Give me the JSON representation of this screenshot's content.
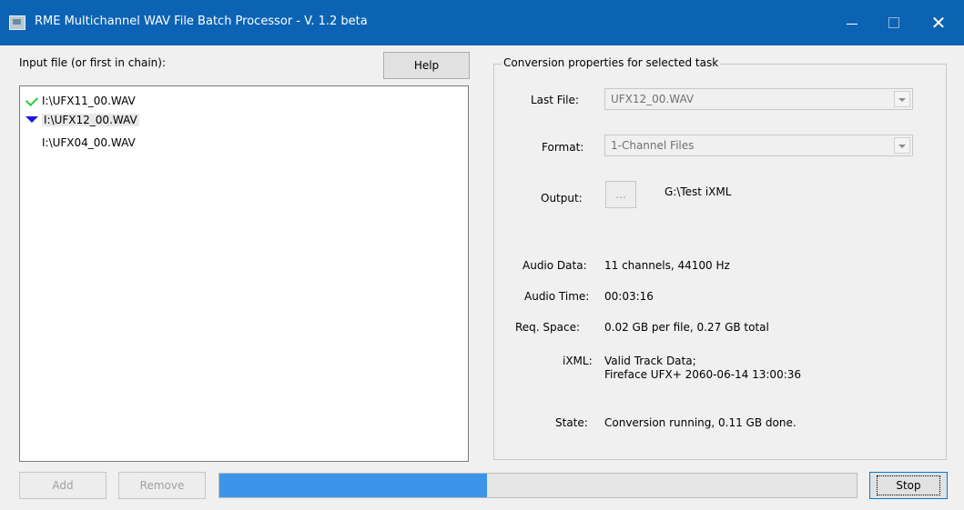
{
  "window": {
    "title": "RME Multichannel WAV File Batch Processor - V. 1.2 beta",
    "close_glyph": "✕"
  },
  "input": {
    "label": "Input file (or first in chain):",
    "help_label": "Help",
    "files": [
      {
        "name": "I:\\UFX11_00.WAV",
        "status_icon": "green-check-icon"
      },
      {
        "name": "I:\\UFX12_00.WAV",
        "status_icon": "blue-chevron-icon",
        "selected": true
      },
      {
        "name": "I:\\UFX04_00.WAV",
        "status_icon": "none"
      }
    ]
  },
  "props": {
    "group_title": "Conversion properties for selected task",
    "last_file_label": "Last File:",
    "last_file_value": "UFX12_00.WAV",
    "format_label": "Format:",
    "format_value": "1-Channel Files",
    "output_label": "Output:",
    "output_browse": "...",
    "output_value": "G:\\Test iXML",
    "audio_data_label": "Audio Data:",
    "audio_data_value": "11 channels, 44100 Hz",
    "audio_time_label": "Audio Time:",
    "audio_time_value": "00:03:16",
    "req_space_label": "Req. Space:",
    "req_space_value": "0.02 GB per file, 0.27 GB total",
    "ixml_label": "iXML:",
    "ixml_value_line1": "Valid Track Data;",
    "ixml_value_line2": "Fireface UFX+ 2060-06-14 13:00:36",
    "state_label": "State:",
    "state_value": "Conversion running, 0.11 GB done."
  },
  "footer": {
    "add_label": "Add",
    "remove_label": "Remove",
    "progress_fraction": 0.42,
    "stop_label": "Stop"
  },
  "colors": {
    "titlebar": "#0c63b4",
    "progress_fill": "#3c95e8",
    "check": "#2ecc40",
    "chevron": "#1a1ae6"
  }
}
